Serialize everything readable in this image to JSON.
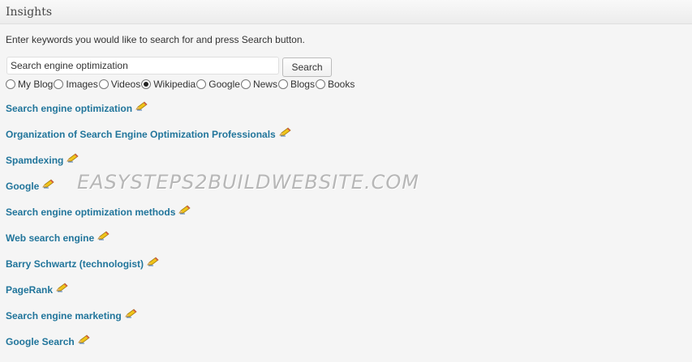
{
  "panel": {
    "title": "Insights"
  },
  "instructions": "Enter keywords you would like to search for and press Search button.",
  "search": {
    "value": "Search engine optimization",
    "button_label": "Search"
  },
  "sources": [
    {
      "label": "My Blog",
      "checked": false
    },
    {
      "label": "Images",
      "checked": false
    },
    {
      "label": "Videos",
      "checked": false
    },
    {
      "label": "Wikipedia",
      "checked": true
    },
    {
      "label": "Google",
      "checked": false
    },
    {
      "label": "News",
      "checked": false
    },
    {
      "label": "Blogs",
      "checked": false
    },
    {
      "label": "Books",
      "checked": false
    }
  ],
  "results": [
    {
      "title": "Search engine optimization",
      "icon": "insert-pencil-icon"
    },
    {
      "title": "Organization of Search Engine Optimization Professionals",
      "icon": "insert-pencil-icon"
    },
    {
      "title": "Spamdexing",
      "icon": "insert-pencil-icon"
    },
    {
      "title": "Google",
      "icon": "insert-pencil-icon"
    },
    {
      "title": "Search engine optimization methods",
      "icon": "insert-pencil-icon"
    },
    {
      "title": "Web search engine",
      "icon": "insert-pencil-icon"
    },
    {
      "title": "Barry Schwartz (technologist)",
      "icon": "insert-pencil-icon"
    },
    {
      "title": "PageRank",
      "icon": "insert-pencil-icon"
    },
    {
      "title": "Search engine marketing",
      "icon": "insert-pencil-icon"
    },
    {
      "title": "Google Search",
      "icon": "insert-pencil-icon"
    }
  ],
  "watermark": "EASYSTEPS2BUILDWEBSITE.COM",
  "colors": {
    "link": "#21759b",
    "background": "#f5f5f5",
    "header": "#ececec"
  }
}
